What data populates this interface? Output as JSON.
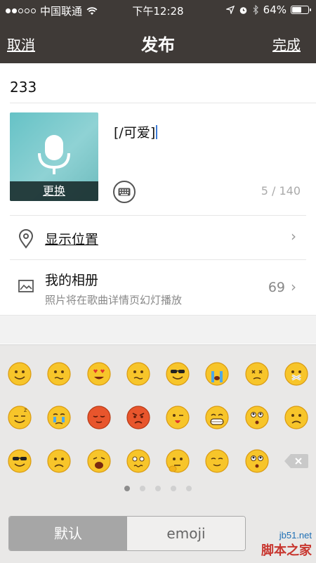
{
  "status_bar": {
    "carrier": "中国联通",
    "time": "下午12:28",
    "battery_percent": "64%",
    "battery_level": 0.64,
    "signal_dots_filled": 2,
    "signal_dots_total": 5,
    "icons": [
      "wifi-icon",
      "location-arrow-icon",
      "alarm-icon",
      "bluetooth-icon",
      "battery-icon"
    ]
  },
  "nav": {
    "cancel": "取消",
    "title": "发布",
    "done": "完成"
  },
  "post": {
    "title_value": "233",
    "content_value": "[/可爱]",
    "cover_replace_label": "更换",
    "counter": "5 / 140"
  },
  "location": {
    "label": "显示位置",
    "icon": "location-pin-icon"
  },
  "album": {
    "label": "我的相册",
    "subtitle": "照片将在歌曲详情页幻灯播放",
    "count": "69",
    "icon": "image-icon"
  },
  "emoji_panel": {
    "rows": [
      [
        "smile",
        "awkward",
        "heart-eyes",
        "confused",
        "cool",
        "crying",
        "dizzy",
        "silent"
      ],
      [
        "sleepy",
        "sweat",
        "shy",
        "angry",
        "wink",
        "grin",
        "surprised",
        "sad"
      ],
      [
        "sunglasses",
        "pitiful",
        "cry-hard",
        "scared",
        "thinking",
        "calm",
        "rolling-eyes"
      ]
    ],
    "pages": 5,
    "active_page": 1,
    "tabs": [
      "默认",
      "emoji"
    ],
    "active_tab": "默认"
  },
  "watermark": {
    "line1": "jb51.net",
    "line2": "脚本之家"
  },
  "colors": {
    "nav_bg": "#3f3a37",
    "emoji_panel_bg": "#e9e8e7",
    "cover_teal": "#66c2c6",
    "caret_blue": "#3d7bd6"
  }
}
